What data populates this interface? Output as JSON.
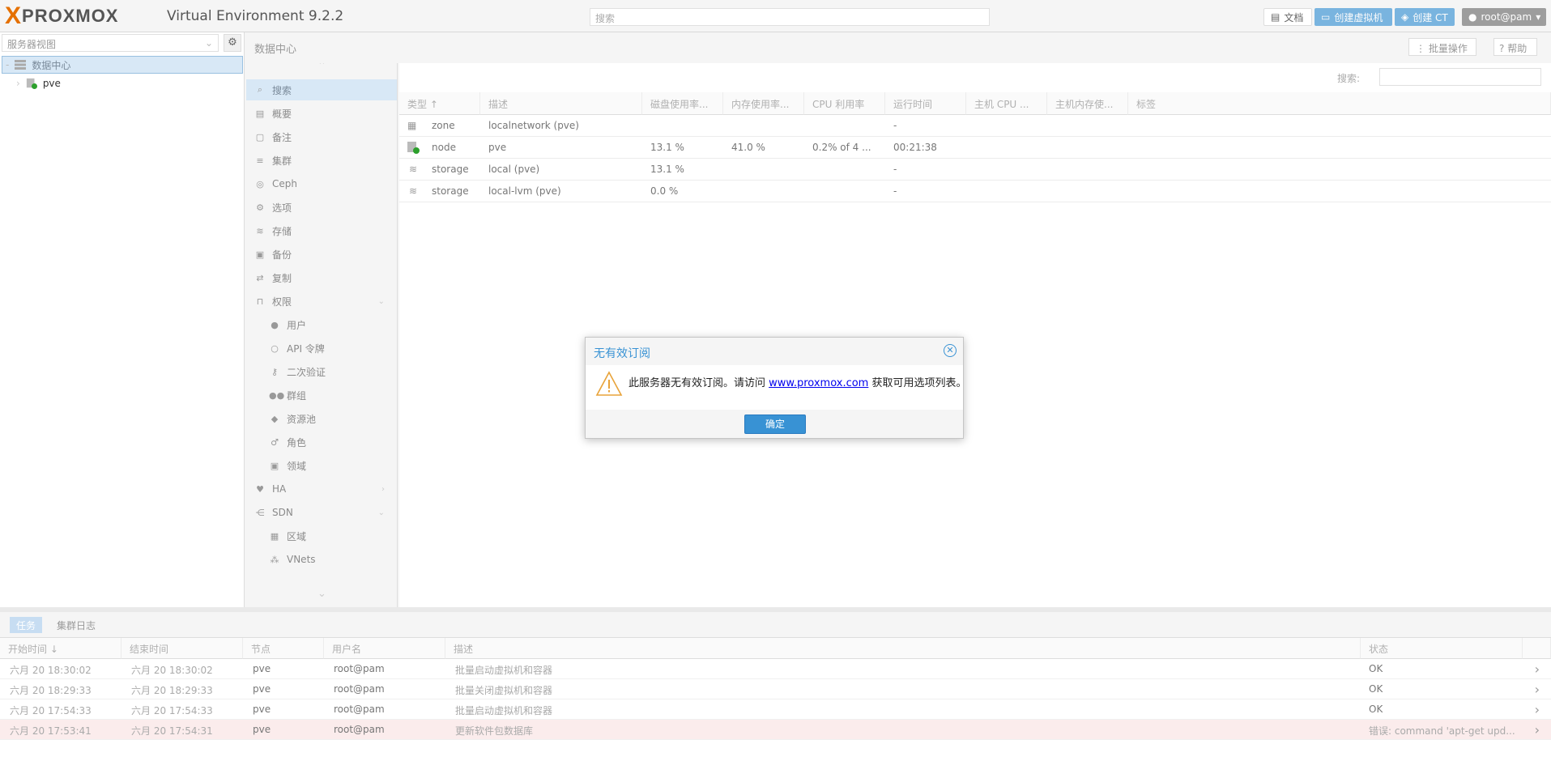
{
  "app": {
    "logo_x": "X",
    "logo_text": "PROXMOX",
    "version": "Virtual Environment 9.2.2",
    "search_placeholder": "搜索"
  },
  "toolbar": {
    "docs": "文档",
    "create_vm": "创建虚拟机",
    "create_ct": "创建 CT",
    "user": "root@pam"
  },
  "left": {
    "view": "服务器视图",
    "tree": [
      {
        "label": "数据中心"
      },
      {
        "label": "pve"
      }
    ]
  },
  "content": {
    "breadcrumb": "数据中心",
    "bulk": "批量操作",
    "help": "帮助",
    "search_label": "搜索:"
  },
  "menu": [
    {
      "label": "搜索",
      "icon": "search-icon"
    },
    {
      "label": "概要",
      "icon": "book-icon"
    },
    {
      "label": "备注",
      "icon": "note-icon"
    },
    {
      "label": "集群",
      "icon": "server-icon"
    },
    {
      "label": "Ceph",
      "icon": "ceph-icon"
    },
    {
      "label": "选项",
      "icon": "gear-icon"
    },
    {
      "label": "存储",
      "icon": "database-icon"
    },
    {
      "label": "备份",
      "icon": "floppy-icon"
    },
    {
      "label": "复制",
      "icon": "retweet-icon"
    },
    {
      "label": "权限",
      "icon": "unlock-icon"
    },
    {
      "label": "用户",
      "icon": "user-icon"
    },
    {
      "label": "API 令牌",
      "icon": "user-outline-icon"
    },
    {
      "label": "二次验证",
      "icon": "key-icon"
    },
    {
      "label": "群组",
      "icon": "users-icon"
    },
    {
      "label": "资源池",
      "icon": "tags-icon"
    },
    {
      "label": "角色",
      "icon": "male-icon"
    },
    {
      "label": "领域",
      "icon": "address-book-icon"
    },
    {
      "label": "HA",
      "icon": "heartbeat-icon"
    },
    {
      "label": "SDN",
      "icon": "share-icon"
    },
    {
      "label": "区域",
      "icon": "grid-icon"
    },
    {
      "label": "VNets",
      "icon": "network-icon"
    }
  ],
  "grid": {
    "headers": [
      "类型 ↑",
      "描述",
      "磁盘使用率...",
      "内存使用率...",
      "CPU 利用率",
      "运行时间",
      "主机 CPU ...",
      "主机内存使...",
      "标签"
    ],
    "rows": [
      {
        "type": "zone",
        "desc": "localnetwork (pve)",
        "disk": "",
        "mem": "",
        "cpu": "",
        "uptime": "-"
      },
      {
        "type": "node",
        "desc": "pve",
        "disk": "13.1 %",
        "mem": "41.0 %",
        "cpu": "0.2% of 4 ...",
        "uptime": "00:21:38"
      },
      {
        "type": "storage",
        "desc": "local (pve)",
        "disk": "13.1 %",
        "mem": "",
        "cpu": "",
        "uptime": "-"
      },
      {
        "type": "storage",
        "desc": "local-lvm (pve)",
        "disk": "0.0 %",
        "mem": "",
        "cpu": "",
        "uptime": "-"
      }
    ]
  },
  "tasks": {
    "tabs": [
      "任务",
      "集群日志"
    ],
    "headers": [
      "开始时间 ↓",
      "结束时间",
      "节点",
      "用户名",
      "描述",
      "状态"
    ],
    "rows": [
      {
        "start": "六月 20 18:30:02",
        "end": "六月 20 18:30:02",
        "node": "pve",
        "user": "root@pam",
        "desc": "批量启动虚拟机和容器",
        "status": "OK"
      },
      {
        "start": "六月 20 18:29:33",
        "end": "六月 20 18:29:33",
        "node": "pve",
        "user": "root@pam",
        "desc": "批量关闭虚拟机和容器",
        "status": "OK"
      },
      {
        "start": "六月 20 17:54:33",
        "end": "六月 20 17:54:33",
        "node": "pve",
        "user": "root@pam",
        "desc": "批量启动虚拟机和容器",
        "status": "OK"
      },
      {
        "start": "六月 20 17:53:41",
        "end": "六月 20 17:54:31",
        "node": "pve",
        "user": "root@pam",
        "desc": "更新软件包数据库",
        "status": "错误: command 'apt-get upd..."
      }
    ]
  },
  "dialog": {
    "title": "无有效订阅",
    "msg_before": "此服务器无有效订阅。请访问 ",
    "link": "www.proxmox.com",
    "msg_after": " 获取可用选项列表。",
    "ok": "确定"
  },
  "colors": {
    "accent": "#3892d4",
    "brand": "#e57000",
    "error_row": "#fbecec"
  }
}
